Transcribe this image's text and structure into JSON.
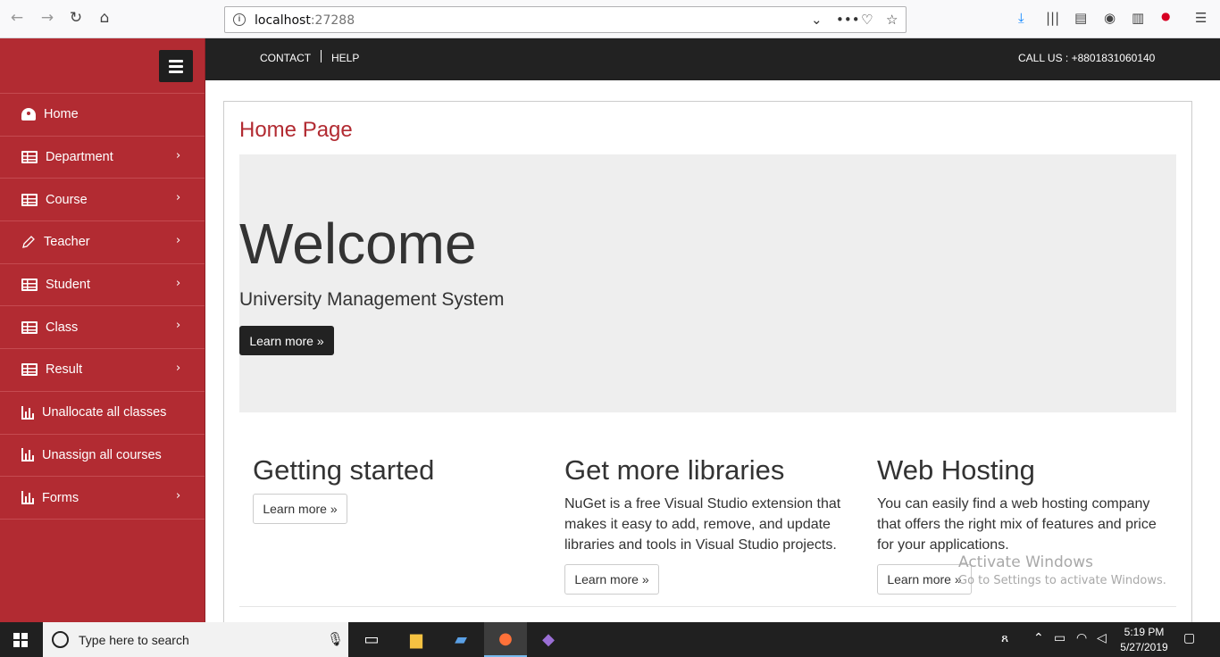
{
  "browser": {
    "url_host": "localhost",
    "url_port": ":27288"
  },
  "sidebar": {
    "items": [
      {
        "label": "Home",
        "icon": "dashboard-icon",
        "has_submenu": false
      },
      {
        "label": "Department",
        "icon": "table-icon",
        "has_submenu": true
      },
      {
        "label": "Course",
        "icon": "table-icon",
        "has_submenu": true
      },
      {
        "label": "Teacher",
        "icon": "pencil-icon",
        "has_submenu": true
      },
      {
        "label": "Student",
        "icon": "table-icon",
        "has_submenu": true
      },
      {
        "label": "Class",
        "icon": "table-icon",
        "has_submenu": true
      },
      {
        "label": "Result",
        "icon": "table-icon",
        "has_submenu": true
      },
      {
        "label": "Unallocate all classes",
        "icon": "bar-chart-icon",
        "has_submenu": false
      },
      {
        "label": "Unassign all courses",
        "icon": "bar-chart-icon",
        "has_submenu": false
      },
      {
        "label": "Forms",
        "icon": "bar-chart-icon",
        "has_submenu": true
      }
    ]
  },
  "topnav": {
    "contact": "CONTACT",
    "help": "HELP",
    "call_us": "CALL US : +8801831060140"
  },
  "main": {
    "page_title": "Home Page",
    "jumbotron": {
      "heading": "Welcome",
      "subtitle": "University Management System",
      "button": "Learn more »"
    },
    "columns": [
      {
        "heading": "Getting started",
        "text": "",
        "button": "Learn more »"
      },
      {
        "heading": "Get more libraries",
        "text": "NuGet is a free Visual Studio extension that makes it easy to add, remove, and update libraries and tools in Visual Studio projects.",
        "button": "Learn more »"
      },
      {
        "heading": "Web Hosting",
        "text": "You can easily find a web hosting company that offers the right mix of features and price for your applications.",
        "button": "Learn more »"
      }
    ]
  },
  "watermark": {
    "title": "Activate Windows",
    "subtitle": "Go to Settings to activate Windows."
  },
  "taskbar": {
    "search_placeholder": "Type here to search",
    "time": "5:19 PM",
    "date": "5/27/2019"
  },
  "colors": {
    "sidebar": "#b22b32",
    "topnav": "#222222",
    "accent": "#b22b32"
  }
}
